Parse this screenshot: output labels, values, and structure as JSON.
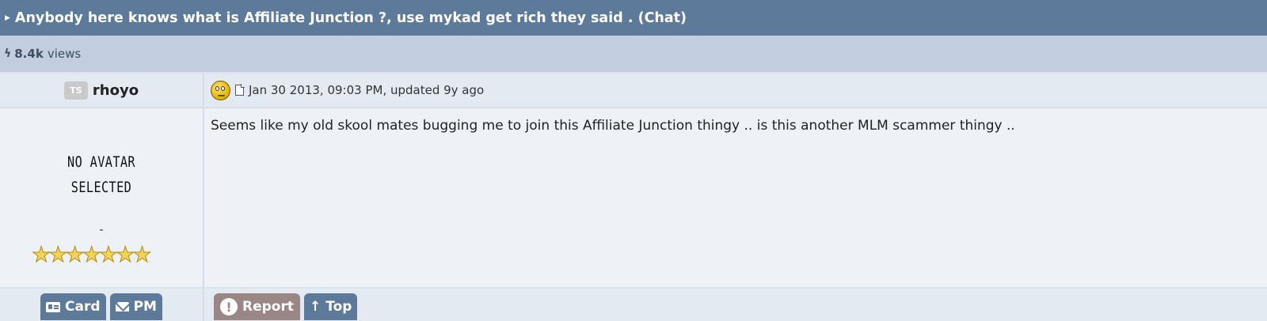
{
  "topic": {
    "title": "Anybody here knows what is Affiliate Junction ?, use mykad get rich they said . (Chat)"
  },
  "stats": {
    "views_count": "8.4k",
    "views_label": "views"
  },
  "post": {
    "author_badge": "TS",
    "author_name": "rhoyo",
    "meta_text": "Jan 30 2013, 09:03 PM, updated 9y ago",
    "avatar_text": [
      "NO AVATAR",
      "SELECTED"
    ],
    "member_title": "-",
    "rating_stars": 7,
    "message": "Seems like my old skool mates bugging me to join this Affiliate Junction thingy .. is this another MLM scammer thingy .."
  },
  "actions": {
    "card_label": "Card",
    "pm_label": "PM",
    "report_label": "Report",
    "top_label": "Top"
  },
  "colors": {
    "header_bg": "#5d7a9b",
    "stats_bg": "#c2cde0",
    "report_bg": "#9a8685",
    "star": "#f3d35b"
  }
}
